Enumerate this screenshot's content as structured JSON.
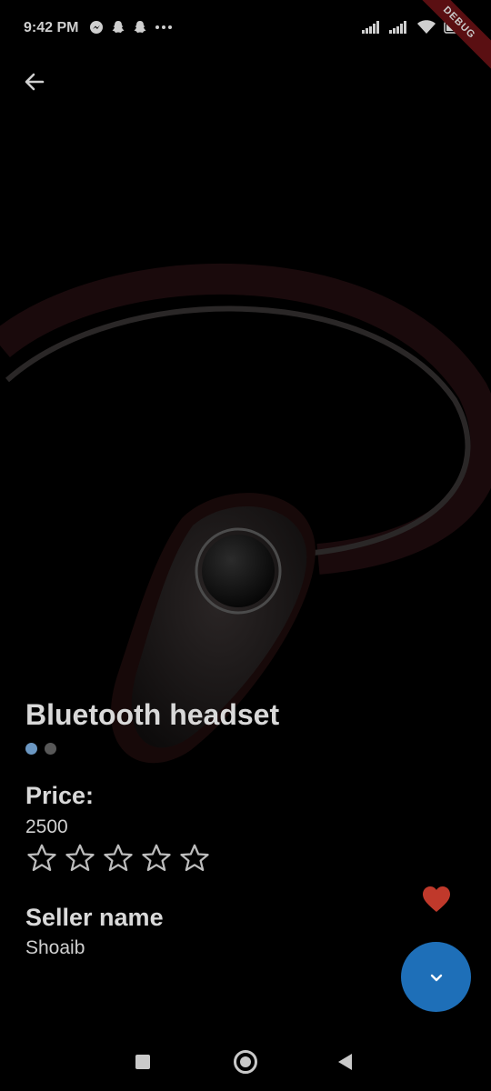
{
  "status_bar": {
    "time": "9:42 PM",
    "left_icons": [
      "messenger-icon",
      "snapchat-icon",
      "snapchat-icon",
      "more-dots-icon"
    ],
    "right_icons": [
      "signal-icon",
      "signal-icon",
      "wifi-icon",
      "battery-icon"
    ],
    "debug_banner": "DEBUG"
  },
  "product": {
    "title": "Bluetooth headset",
    "image_count": 2,
    "active_image_index": 0,
    "price_label": "Price:",
    "price_value": "2500",
    "rating": 0,
    "max_rating": 5,
    "seller_label": "Seller name",
    "seller_value": "Shoaib"
  },
  "colors": {
    "background": "#000000",
    "fab": "#1e6fb8",
    "favorite": "#c0392b",
    "dot_active": "#6b97c2",
    "dot_inactive": "#585858"
  },
  "icons": {
    "back": "arrow-left-icon",
    "favorite": "heart-icon",
    "fab": "chevron-down-icon",
    "nav": [
      "recent-apps-icon",
      "home-icon",
      "back-icon"
    ]
  }
}
